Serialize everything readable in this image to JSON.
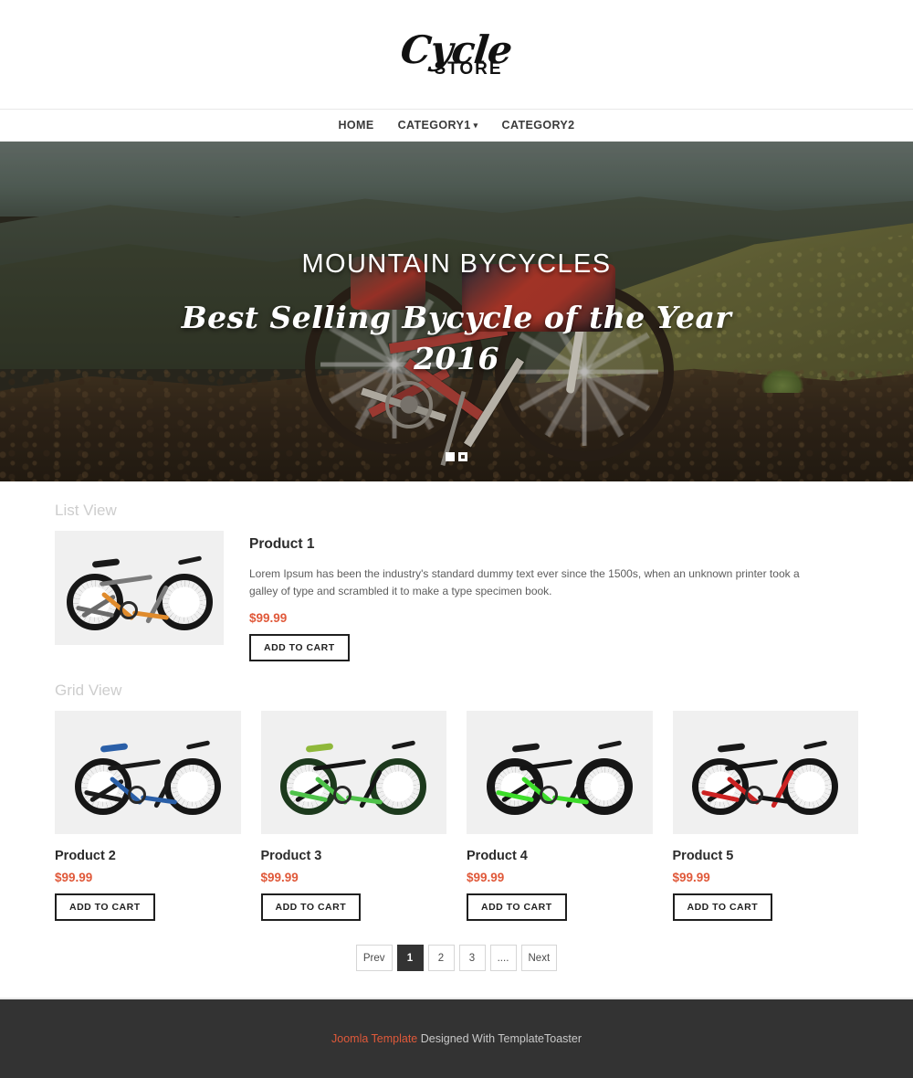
{
  "header": {
    "logo_script": "Cycle",
    "logo_store": "STORE"
  },
  "nav": {
    "items": [
      {
        "label": "HOME",
        "has_dropdown": false
      },
      {
        "label": "CATEGORY1",
        "has_dropdown": true
      },
      {
        "label": "CATEGORY2",
        "has_dropdown": false
      }
    ]
  },
  "hero": {
    "title": "MOUNTAIN BYCYCLES",
    "subtitle_line1": "Best Selling Bycycle of the Year",
    "subtitle_line2": "2016",
    "slides": 2,
    "active_slide": 2
  },
  "list_section": {
    "label": "List View",
    "product": {
      "title": "Product 1",
      "description": "Lorem Ipsum has been the industry's standard dummy text ever since the 1500s, when an unknown printer took a galley of type and scrambled it to make a type specimen book.",
      "price": "$99.99",
      "button": "ADD TO CART"
    }
  },
  "grid_section": {
    "label": "Grid View",
    "products": [
      {
        "title": "Product 2",
        "price": "$99.99",
        "button": "ADD TO CART"
      },
      {
        "title": "Product 3",
        "price": "$99.99",
        "button": "ADD TO CART"
      },
      {
        "title": "Product 4",
        "price": "$99.99",
        "button": "ADD TO CART"
      },
      {
        "title": "Product 5",
        "price": "$99.99",
        "button": "ADD TO CART"
      }
    ]
  },
  "pagination": {
    "prev": "Prev",
    "pages": [
      "1",
      "2",
      "3",
      "...."
    ],
    "active_page": "1",
    "next": "Next"
  },
  "footer": {
    "link_text": "Joomla Template",
    "text": " Designed With TemplateToaster"
  },
  "colors": {
    "price": "#e0593a",
    "footer_bg": "#333333",
    "accent_link": "#e0593a",
    "thumb_bg": "#f0f0f0",
    "pager_active_bg": "#333333"
  }
}
